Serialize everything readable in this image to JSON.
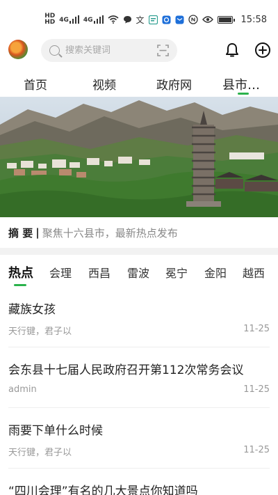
{
  "status_bar": {
    "network1": "HD",
    "network2": "HD",
    "signal1": "4G",
    "signal2": "4G",
    "time": "15:58",
    "battery_level": 0.9
  },
  "header": {
    "search_placeholder": "搜索关键词"
  },
  "top_nav": {
    "tabs": [
      {
        "label": "首页"
      },
      {
        "label": "视频"
      },
      {
        "label": "政府网"
      },
      {
        "label": "县市…"
      }
    ]
  },
  "summary": {
    "label": "摘 要",
    "separator": "|",
    "text": "聚焦十六县市，最新热点发布"
  },
  "category_tabs": [
    {
      "label": "热点"
    },
    {
      "label": "会理"
    },
    {
      "label": "西昌"
    },
    {
      "label": "雷波"
    },
    {
      "label": "冕宁"
    },
    {
      "label": "金阳"
    },
    {
      "label": "越西"
    }
  ],
  "news": [
    {
      "title": "藏族女孩",
      "meta": "天行键，君子以",
      "date": "11-25"
    },
    {
      "title": "会东县十七届人民政府召开第112次常务会议",
      "meta": "admin",
      "date": "11-25"
    },
    {
      "title": "雨要下单什么时候",
      "meta": "天行键，君子以",
      "date": "11-25"
    },
    {
      "title": "“四川会理”有名的几大景点你知道吗",
      "meta": "",
      "date": ""
    }
  ],
  "colors": {
    "accent": "#2bb24c"
  }
}
